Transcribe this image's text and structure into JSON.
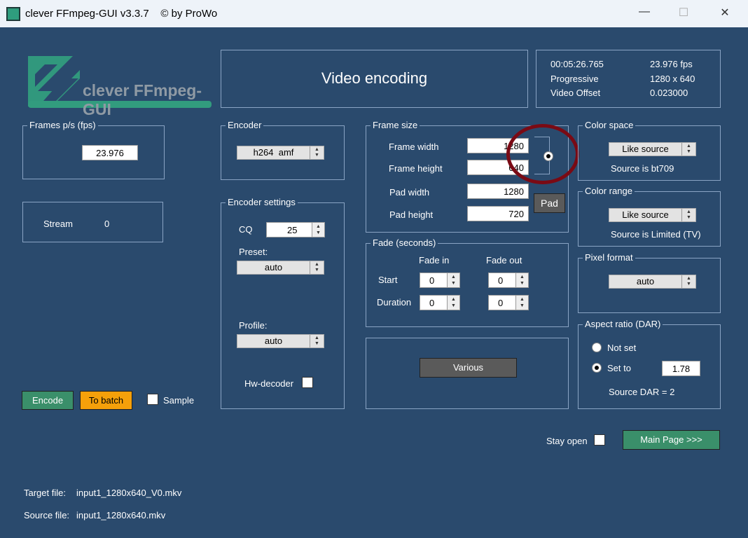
{
  "window": {
    "title": "clever FFmpeg-GUI v3.3.7    © by ProWo",
    "minimize": "—",
    "maximize": "☐",
    "close": "✕"
  },
  "logo": {
    "text": "clever FFmpeg-GUI"
  },
  "header": {
    "title": "Video encoding"
  },
  "info": {
    "duration": "00:05:26.765",
    "fps": "23.976 fps",
    "scan": "Progressive",
    "resolution": "1280 x 640",
    "offset_label": "Video Offset",
    "offset": "0.023000"
  },
  "fps_group": {
    "label": "Frames p/s (fps)",
    "value": "23.976"
  },
  "stream": {
    "label": "Stream",
    "value": "0"
  },
  "encoder": {
    "label": "Encoder",
    "value": "h264  amf"
  },
  "encoder_settings": {
    "label": "Encoder settings",
    "cq_label": "CQ",
    "cq": "25",
    "preset_label": "Preset:",
    "preset": "auto",
    "profile_label": "Profile:",
    "profile": "auto",
    "hw_label": "Hw-decoder"
  },
  "frame_size": {
    "label": "Frame size",
    "width_label": "Frame width",
    "width": "1280",
    "height_label": "Frame height",
    "height": "640",
    "pad_width_label": "Pad width",
    "pad_width": "1280",
    "pad_height_label": "Pad height",
    "pad_height": "720",
    "pad_button": "Pad"
  },
  "fade": {
    "label": "Fade (seconds)",
    "in_label": "Fade in",
    "out_label": "Fade out",
    "start_label": "Start",
    "duration_label": "Duration",
    "start_in": "0",
    "start_out": "0",
    "dur_in": "0",
    "dur_out": "0"
  },
  "various_button": "Various",
  "color_space": {
    "label": "Color space",
    "value": "Like source",
    "note": "Source is bt709"
  },
  "color_range": {
    "label": "Color range",
    "value": "Like source",
    "note": "Source is Limited (TV)"
  },
  "pixel_format": {
    "label": "Pixel format",
    "value": "auto"
  },
  "aspect": {
    "label": "Aspect ratio (DAR)",
    "not_set": "Not set",
    "set_to": "Set to",
    "value": "1.78",
    "note": "Source DAR = 2"
  },
  "actions": {
    "encode": "Encode",
    "batch": "To batch",
    "sample": "Sample",
    "stay_open": "Stay open",
    "main_page": "Main Page >>>"
  },
  "files": {
    "target_label": "Target file:",
    "target": "input1_1280x640_V0.mkv",
    "source_label": "Source file:",
    "source": "input1_1280x640.mkv"
  },
  "colors": {
    "bg": "#2a4a6d",
    "green": "#3a8f6a",
    "orange": "#f5a00a",
    "annotation": "#7a0a14"
  }
}
